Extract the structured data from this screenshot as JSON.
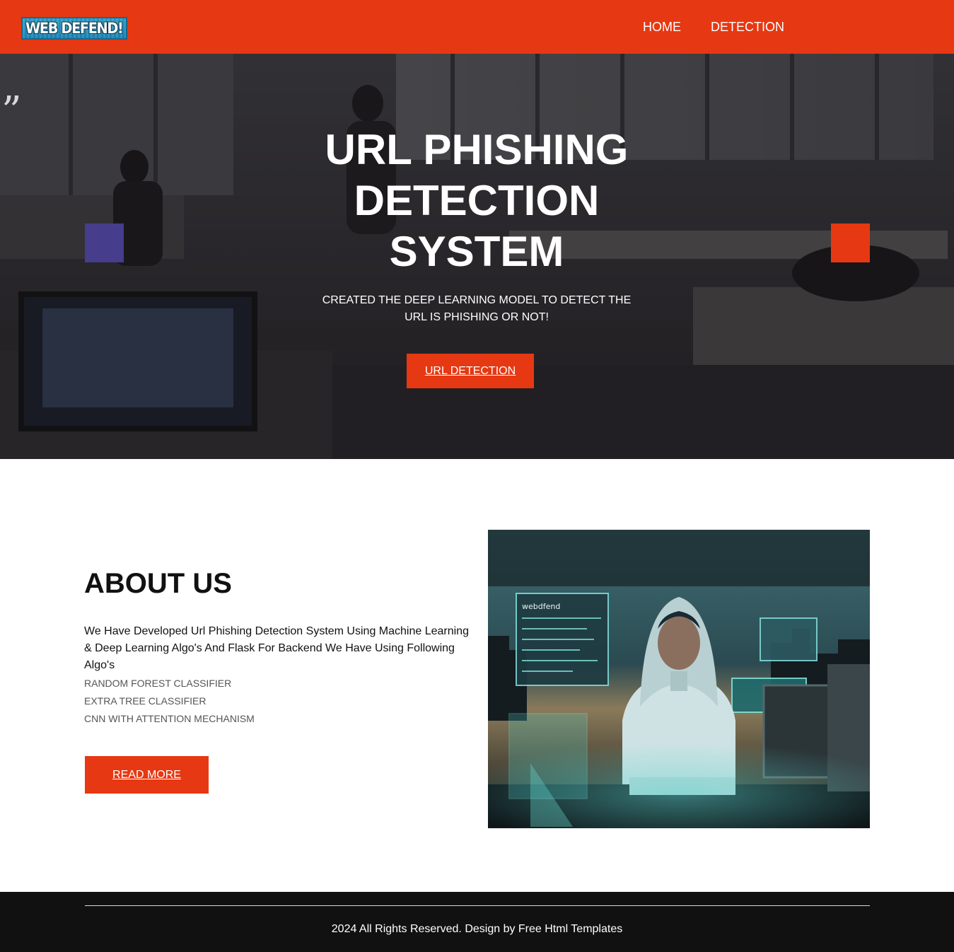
{
  "header": {
    "logo_text": "WEB DEFEND!",
    "nav": [
      {
        "label": "HOME"
      },
      {
        "label": "DETECTION"
      }
    ],
    "bg_color": "#e63812"
  },
  "hero": {
    "title_line1": "URL PHISHING",
    "title_line2": "DETECTION",
    "title_line3": "SYSTEM",
    "subtitle": "CREATED THE DEEP LEARNING MODEL TO DETECT THE URL IS PHISHING OR NOT!",
    "button_label": "URL DETECTION",
    "quote_mark": "”",
    "accent_left": "#463d8c",
    "accent_right": "#e63812"
  },
  "about": {
    "title": "ABOUT US",
    "text": "We Have Developed Url Phishing Detection System Using Machine Learning & Deep Learning Algo's And Flask For Backend We Have Using Following Algo's",
    "list": [
      "RANDOM FOREST CLASSIFIER",
      "EXTRA TREE CLASSIFIER",
      "CNN WITH ATTENTION MECHANISM"
    ],
    "button_label": "READ MORE",
    "image_screen_text": "webdfend"
  },
  "footer": {
    "text": "2024 All Rights Reserved. Design by Free Html Templates"
  }
}
